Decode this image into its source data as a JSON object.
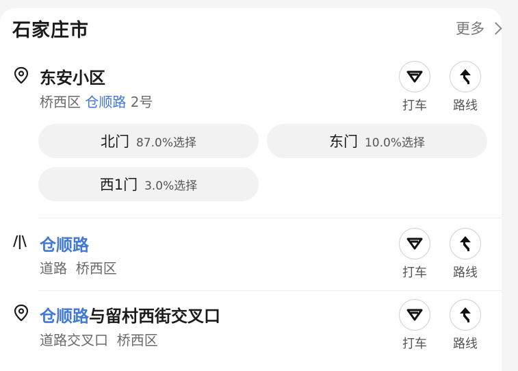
{
  "header": {
    "city": "石家庄市",
    "more_label": "更多"
  },
  "actions": {
    "taxi_label": "打车",
    "route_label": "路线"
  },
  "results": [
    {
      "icon": "location-pin-icon",
      "title": "东安小区",
      "subtitle_prefix": "桥西区 ",
      "subtitle_highlight": "仓顺路",
      "subtitle_suffix": " 2号",
      "gates": [
        {
          "name": "北门",
          "percent": "87.0%选择"
        },
        {
          "name": "东门",
          "percent": "10.0%选择"
        },
        {
          "name": "西1门",
          "percent": "3.0%选择"
        }
      ]
    },
    {
      "icon": "road-icon",
      "icon_text": "/|\\",
      "title_highlight": "仓顺路",
      "subtitle": "道路  桥西区"
    },
    {
      "icon": "location-pin-icon",
      "title_highlight": "仓顺路",
      "title_rest": "与留村西街交叉口",
      "subtitle": "道路交叉口  桥西区"
    }
  ],
  "colors": {
    "highlight": "#3f78d9",
    "background": "#f5f5f5",
    "card": "#ffffff",
    "pill": "#f2f2f2"
  }
}
